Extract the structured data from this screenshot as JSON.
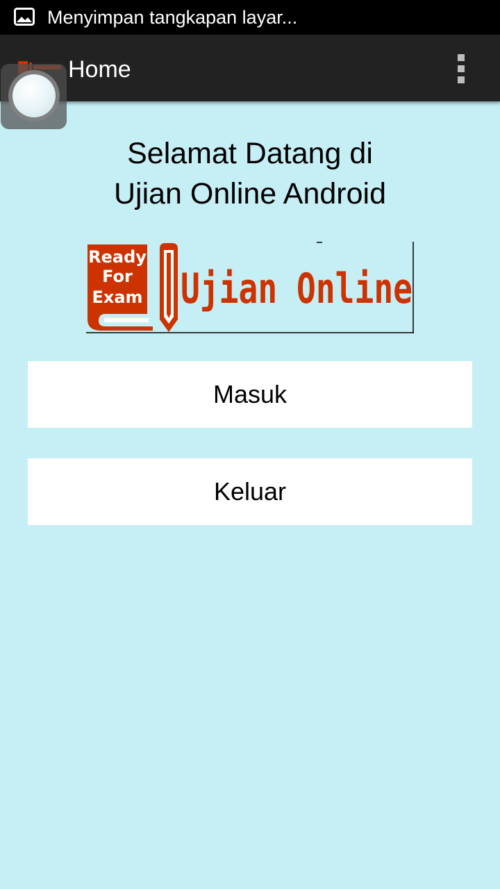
{
  "status_bar": {
    "notification_text": "Menyimpan tangkapan layar...",
    "icon": "image-icon"
  },
  "action_bar": {
    "title": "Home",
    "overflow_icon": "more-vert-icon"
  },
  "main": {
    "welcome_line1": "Selamat Datang di",
    "welcome_line2": "Ujian Online Android",
    "logo": {
      "badge_line1": "Ready",
      "badge_line2": "For",
      "badge_line3": "Exam",
      "wordmark": "Ujian Online",
      "brand_color": "#cc3300"
    },
    "buttons": {
      "masuk_label": "Masuk",
      "keluar_label": "Keluar"
    }
  },
  "colors": {
    "background": "#c5eef5",
    "action_bar": "#222222",
    "status_bar": "#000000"
  }
}
